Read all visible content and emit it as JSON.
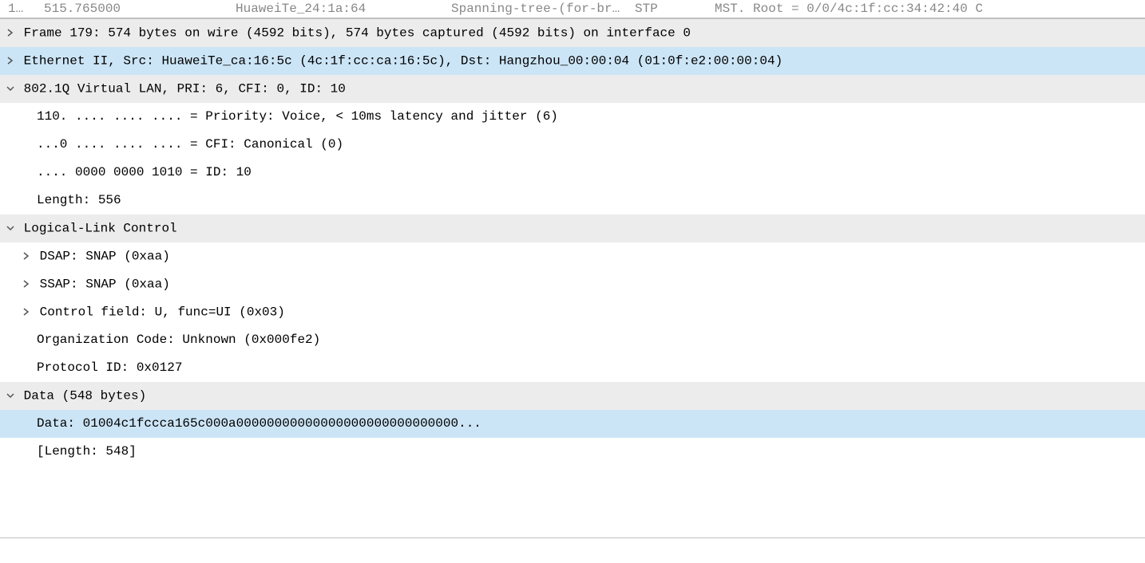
{
  "packet_list": {
    "no": "1…",
    "time": "515.765000",
    "source": "HuaweiTe_24:1a:64",
    "destination": "Spanning-tree-(for-br…",
    "protocol": "STP",
    "info": "MST. Root = 0/0/4c:1f:cc:34:42:40  C"
  },
  "details": {
    "frame": "Frame 179: 574 bytes on wire (4592 bits), 574 bytes captured (4592 bits) on interface 0",
    "ethernet": "Ethernet II, Src: HuaweiTe_ca:16:5c (4c:1f:cc:ca:16:5c), Dst: Hangzhou_00:00:04 (01:0f:e2:00:00:04)",
    "vlan_header": "802.1Q Virtual LAN, PRI: 6, CFI: 0, ID: 10",
    "vlan_priority": "110. .... .... .... = Priority: Voice, < 10ms latency and jitter (6)",
    "vlan_cfi": "...0 .... .... .... = CFI: Canonical (0)",
    "vlan_id": ".... 0000 0000 1010 = ID: 10",
    "vlan_length": "Length: 556",
    "llc_header": "Logical-Link Control",
    "llc_dsap": "DSAP: SNAP (0xaa)",
    "llc_ssap": "SSAP: SNAP (0xaa)",
    "llc_control": "Control field: U, func=UI (0x03)",
    "llc_orgcode": "Organization Code: Unknown (0x000fe2)",
    "llc_protoid": "Protocol ID: 0x0127",
    "data_header": "Data (548 bytes)",
    "data_value": "Data: 01004c1fccca165c000a00000000000000000000000000000...",
    "data_length": "[Length: 548]"
  }
}
